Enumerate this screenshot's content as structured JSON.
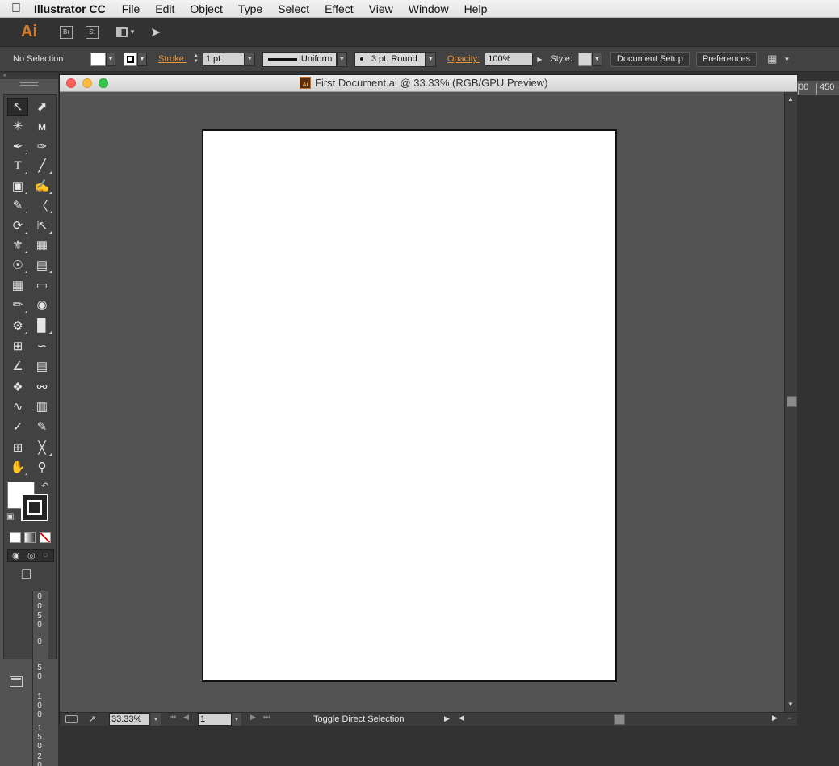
{
  "menubar": {
    "apple_icon": "apple-icon",
    "app_name": "Illustrator CC",
    "items": [
      "File",
      "Edit",
      "Object",
      "Type",
      "Select",
      "Effect",
      "View",
      "Window",
      "Help"
    ]
  },
  "appbar": {
    "logo": "Ai",
    "bridge": "Br",
    "stock": "St"
  },
  "controlbar": {
    "selection": "No Selection",
    "stroke_label": "Stroke:",
    "stroke_weight": "1 pt",
    "profile": "Uniform",
    "brush": "3 pt. Round",
    "opacity_label": "Opacity:",
    "opacity": "100%",
    "style_label": "Style:",
    "document_setup": "Document Setup",
    "preferences": "Preferences"
  },
  "document": {
    "title": "First Document.ai @ 33.33% (RGB/GPU Preview)",
    "file_icon": "Ai"
  },
  "statusbar": {
    "zoom": "33.33%",
    "artboard": "1",
    "status": "Toggle Direct Selection"
  },
  "ruler": {
    "right_labels": [
      "00",
      "450"
    ],
    "left_digits": [
      "0",
      "0",
      "5",
      "0",
      "0",
      "5",
      "0",
      "1",
      "0",
      "0",
      "1",
      "5",
      "0",
      "2",
      "0"
    ]
  },
  "colors": {
    "accent": "#e8953c",
    "canvas": "#535353",
    "chrome": "#424242"
  }
}
